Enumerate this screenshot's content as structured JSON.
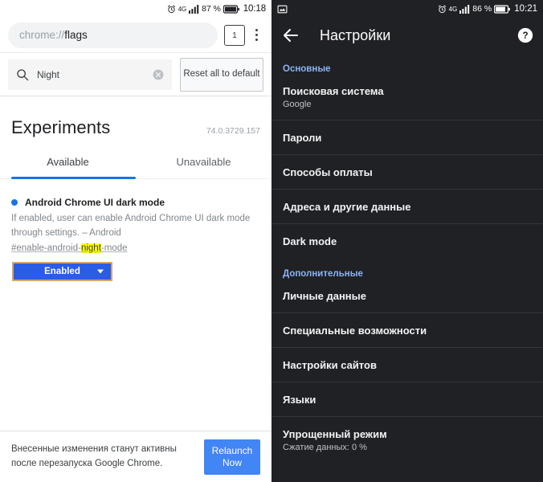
{
  "left": {
    "status_bar": {
      "alarm_icon": "alarm-icon",
      "network": "4G",
      "signal_icon": "signal-bars-icon",
      "battery_pct": "87 %",
      "battery_icon": "battery-icon",
      "time": "10:18"
    },
    "omnibox": {
      "scheme": "chrome://",
      "host": "flags",
      "tab_count": "1",
      "menu_icon": "overflow-menu-icon"
    },
    "search": {
      "icon": "search-icon",
      "value": "Night",
      "clear_icon": "clear-circle-icon",
      "reset_label": "Reset all to default"
    },
    "experiments": {
      "title": "Experiments",
      "version": "74.0.3729.157",
      "tabs": [
        {
          "label": "Available",
          "active": true
        },
        {
          "label": "Unavailable",
          "active": false
        }
      ]
    },
    "flag": {
      "dot_icon": "status-dot-icon",
      "title": "Android Chrome UI dark mode",
      "description": "If enabled, user can enable Android Chrome UI dark mode through settings. – Android",
      "id_prefix": "#enable-android-",
      "id_highlight": "night",
      "id_suffix": "-mode",
      "select_value": "Enabled",
      "caret_icon": "chevron-down-icon"
    },
    "relaunch": {
      "message": "Внесенные изменения станут активны после перезапуска Google Chrome.",
      "button_label": "Relaunch Now"
    }
  },
  "right": {
    "status_bar": {
      "notification_icon": "screenshot-notification-icon",
      "alarm_icon": "alarm-icon",
      "network": "4G",
      "signal_icon": "signal-bars-icon",
      "battery_pct": "86 %",
      "battery_icon": "battery-icon",
      "time": "10:21"
    },
    "appbar": {
      "back_icon": "back-arrow-icon",
      "title": "Настройки",
      "help_icon": "help-circle-icon"
    },
    "sections": [
      {
        "label": "Основные",
        "items": [
          {
            "title": "Поисковая система",
            "subtitle": "Google"
          },
          {
            "title": "Пароли",
            "subtitle": ""
          },
          {
            "title": "Способы оплаты",
            "subtitle": ""
          },
          {
            "title": "Адреса и другие данные",
            "subtitle": ""
          },
          {
            "title": "Dark mode",
            "subtitle": ""
          }
        ]
      },
      {
        "label": "Дополнительные",
        "items": [
          {
            "title": "Личные данные",
            "subtitle": ""
          },
          {
            "title": "Специальные возможности",
            "subtitle": ""
          },
          {
            "title": "Настройки сайтов",
            "subtitle": ""
          },
          {
            "title": "Языки",
            "subtitle": ""
          },
          {
            "title": "Упрощенный режим",
            "subtitle": "Сжатие данных: 0 %"
          }
        ]
      }
    ]
  },
  "colors": {
    "accent_blue": "#1a73e8",
    "button_blue": "#2b5ce6",
    "relaunch_blue": "#4285f4",
    "focus_border": "#d4a76a",
    "highlight_yellow": "#ffff00",
    "dark_bg": "#202124",
    "dark_accent": "#8ab4f8"
  }
}
